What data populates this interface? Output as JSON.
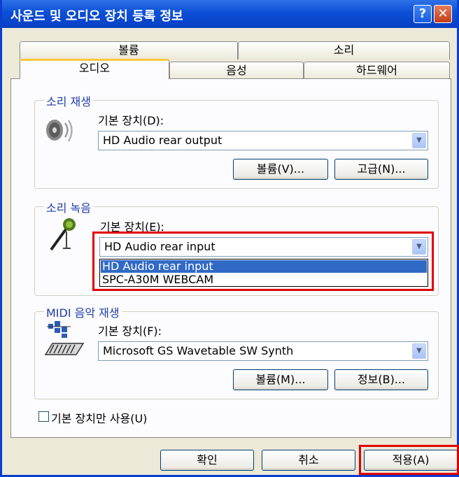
{
  "window": {
    "title": "사운드 및 오디오 장치 등록 정보",
    "help_label": "?",
    "close_label": "✕"
  },
  "tabs": {
    "back_row": [
      "볼륨",
      "소리"
    ],
    "front_row": [
      "오디오",
      "음성",
      "하드웨어"
    ],
    "active": "오디오"
  },
  "playback": {
    "legend": "소리 재생",
    "device_label": "기본 장치(D):",
    "device_value": "HD Audio rear output",
    "volume_button": "볼륨(V)...",
    "advanced_button": "고급(N)...",
    "icon": "speaker-icon"
  },
  "recording": {
    "legend": "소리 녹음",
    "device_label": "기본 장치(E):",
    "device_value": "HD Audio rear input",
    "options": [
      "HD Audio rear input",
      "SPC-A30M WEBCAM"
    ],
    "icon": "microphone-icon"
  },
  "midi": {
    "legend": "MIDI 음악 재생",
    "device_label": "기본 장치(F):",
    "device_value": "Microsoft GS Wavetable SW Synth",
    "volume_button": "볼륨(M)...",
    "info_button": "정보(B)...",
    "icon": "midi-keyboard-icon"
  },
  "default_only_checkbox": {
    "label": "기본 장치만 사용(U)",
    "checked": false
  },
  "footer": {
    "ok": "확인",
    "cancel": "취소",
    "apply": "적용(A)"
  },
  "colors": {
    "titlebar": "#0b4fd6",
    "highlight": "#e00000",
    "selection": "#316ac5",
    "legend_text": "#1c3da8"
  }
}
